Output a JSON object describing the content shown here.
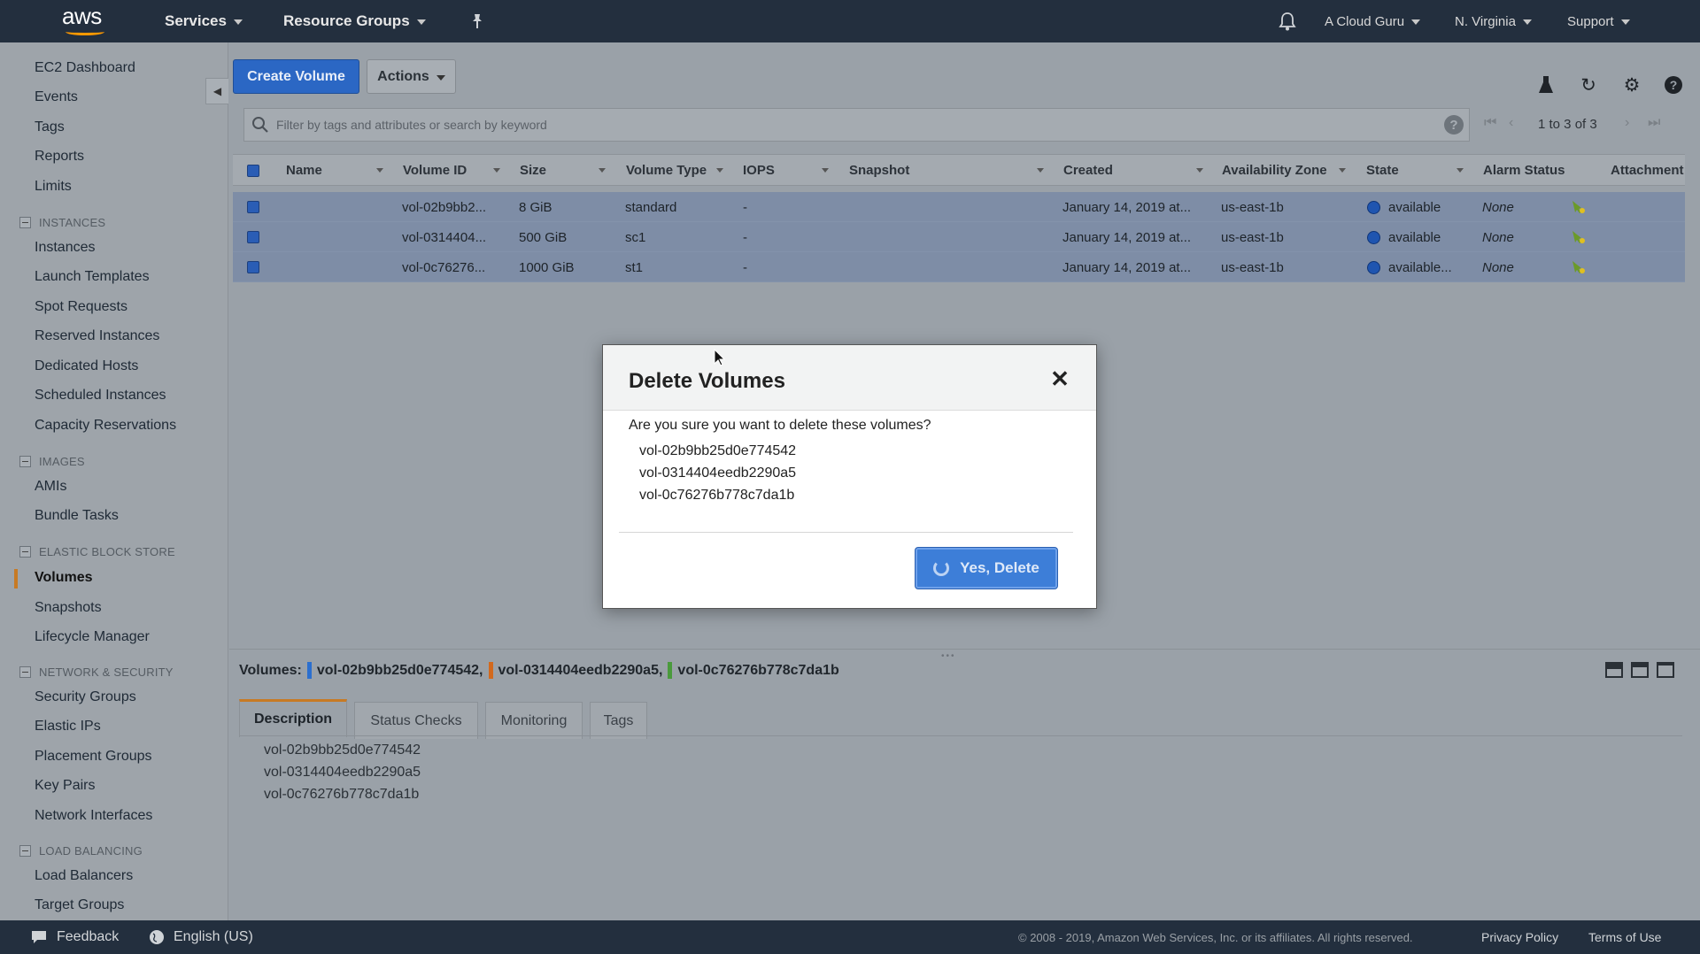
{
  "topnav": {
    "logo_text": "aws",
    "services": "Services",
    "resource_groups": "Resource Groups",
    "account": "A Cloud Guru",
    "region": "N. Virginia",
    "support": "Support"
  },
  "sidebar": {
    "top_links": [
      "EC2 Dashboard",
      "Events",
      "Tags",
      "Reports",
      "Limits"
    ],
    "sections": [
      {
        "title": "INSTANCES",
        "items": [
          "Instances",
          "Launch Templates",
          "Spot Requests",
          "Reserved Instances",
          "Dedicated Hosts",
          "Scheduled Instances",
          "Capacity Reservations"
        ]
      },
      {
        "title": "IMAGES",
        "items": [
          "AMIs",
          "Bundle Tasks"
        ]
      },
      {
        "title": "ELASTIC BLOCK STORE",
        "items": [
          "Volumes",
          "Snapshots",
          "Lifecycle Manager"
        ]
      },
      {
        "title": "NETWORK & SECURITY",
        "items": [
          "Security Groups",
          "Elastic IPs",
          "Placement Groups",
          "Key Pairs",
          "Network Interfaces"
        ]
      },
      {
        "title": "LOAD BALANCING",
        "items": [
          "Load Balancers",
          "Target Groups"
        ]
      }
    ],
    "active_item": "Volumes"
  },
  "toolbar": {
    "create_label": "Create Volume",
    "actions_label": "Actions"
  },
  "search": {
    "placeholder": "Filter by tags and attributes or search by keyword"
  },
  "pager": {
    "text": "1 to 3 of 3"
  },
  "table": {
    "columns": [
      "Name",
      "Volume ID",
      "Size",
      "Volume Type",
      "IOPS",
      "Snapshot",
      "Created",
      "Availability Zone",
      "State",
      "Alarm Status",
      "Attachment"
    ],
    "rows": [
      {
        "name": "",
        "volume_id": "vol-02b9bb2...",
        "size": "8 GiB",
        "type": "standard",
        "iops": "-",
        "snapshot": "",
        "created": "January 14, 2019 at...",
        "az": "us-east-1b",
        "state": "available",
        "alarm": "None"
      },
      {
        "name": "",
        "volume_id": "vol-0314404...",
        "size": "500 GiB",
        "type": "sc1",
        "iops": "-",
        "snapshot": "",
        "created": "January 14, 2019 at...",
        "az": "us-east-1b",
        "state": "available",
        "alarm": "None"
      },
      {
        "name": "",
        "volume_id": "vol-0c76276...",
        "size": "1000 GiB",
        "type": "st1",
        "iops": "-",
        "snapshot": "",
        "created": "January 14, 2019 at...",
        "az": "us-east-1b",
        "state": "available...",
        "alarm": "None"
      }
    ]
  },
  "modal": {
    "title": "Delete Volumes",
    "question": "Are you sure you want to delete these volumes?",
    "volumes": [
      "vol-02b9bb25d0e774542",
      "vol-0314404eedb2290a5",
      "vol-0c76276b778c7da1b"
    ],
    "confirm_label": "Yes, Delete"
  },
  "details": {
    "label": "Volumes:",
    "volumes": [
      {
        "id": "vol-02b9bb25d0e774542,",
        "color": "#2b6fcf"
      },
      {
        "id": "vol-0314404eedb2290a5,",
        "color": "#d2691e"
      },
      {
        "id": "vol-0c76276b778c7da1b",
        "color": "#4a9a3c"
      }
    ],
    "tabs": [
      "Description",
      "Status Checks",
      "Monitoring",
      "Tags"
    ],
    "active_tab": "Description",
    "description_volumes": [
      "vol-02b9bb25d0e774542",
      "vol-0314404eedb2290a5",
      "vol-0c76276b778c7da1b"
    ]
  },
  "footer": {
    "feedback": "Feedback",
    "language": "English (US)",
    "copyright": "© 2008 - 2019, Amazon Web Services, Inc. or its affiliates. All rights reserved.",
    "privacy": "Privacy Policy",
    "terms": "Terms of Use"
  },
  "colors": {
    "nav_bg": "#232f3e",
    "primary": "#2b67c4",
    "active_accent": "#c77a24",
    "selected_row": "#7e8da6"
  }
}
